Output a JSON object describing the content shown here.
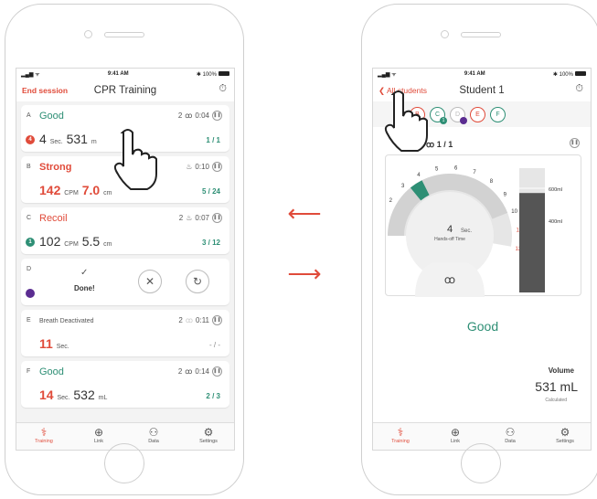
{
  "left_screen": {
    "status_time": "9:41 AM",
    "status_battery": "100%",
    "nav_left": "End session",
    "nav_title": "CPR Training",
    "cards": [
      {
        "letter": "A",
        "status": "Good",
        "count": "2",
        "time": "0:04",
        "metric_num": "4",
        "metric_unit": "Sec.",
        "metric_num2": "531",
        "metric_unit2": "m",
        "ratio": "1 / 1",
        "badge": "4"
      },
      {
        "letter": "B",
        "status": "Strong",
        "time": "0:10",
        "metric_num": "142",
        "metric_unit": "CPM",
        "metric_num2": "7.0",
        "metric_unit2": "cm",
        "ratio": "5 / 24"
      },
      {
        "letter": "C",
        "status": "Recoil",
        "count": "2",
        "time": "0:07",
        "metric_num": "102",
        "metric_unit": "CPM",
        "metric_num2": "5.5",
        "metric_unit2": "cm",
        "ratio": "3 / 12",
        "badge": "1"
      },
      {
        "letter": "D",
        "check": "✓",
        "done": "Done!"
      },
      {
        "letter": "E",
        "status": "Breath Deactivated",
        "count": "2",
        "time": "0:11",
        "metric_num": "11",
        "metric_unit": "Sec.",
        "ratio": "- / -"
      },
      {
        "letter": "F",
        "status": "Good",
        "count": "2",
        "time": "0:14",
        "metric_num": "14",
        "metric_unit": "Sec.",
        "metric_num2": "532",
        "metric_unit2": "mL",
        "ratio": "2 / 3"
      }
    ],
    "tabs": [
      "Training",
      "Link",
      "Data",
      "Settings"
    ]
  },
  "right_screen": {
    "status_time": "9:41 AM",
    "status_battery": "100%",
    "nav_left": "All students",
    "nav_title": "Student 1",
    "students": [
      "B",
      "C",
      "D",
      "E",
      "F"
    ],
    "student_c_badge": "1",
    "ratio": "1 / 1",
    "gauge_center_value": "4",
    "gauge_center_unit": "Sec.",
    "gauge_center_label": "Hands-off Time",
    "gauge_ticks": [
      "0",
      "1",
      "2",
      "3",
      "4",
      "5",
      "6",
      "7",
      "8",
      "9",
      "10",
      "11",
      "12"
    ],
    "gauge_value": 4,
    "volume_ticks": [
      "600ml",
      "400ml"
    ],
    "volume_fill": 0.8,
    "result": "Good",
    "volume_label": "Volume",
    "volume_value": "531 mL",
    "volume_sub": "Calculated",
    "tabs": [
      "Training",
      "Link",
      "Data",
      "Settings"
    ]
  },
  "colors": {
    "accent": "#e04b3a",
    "good": "#2e8f75",
    "purple": "#5b2d91"
  }
}
